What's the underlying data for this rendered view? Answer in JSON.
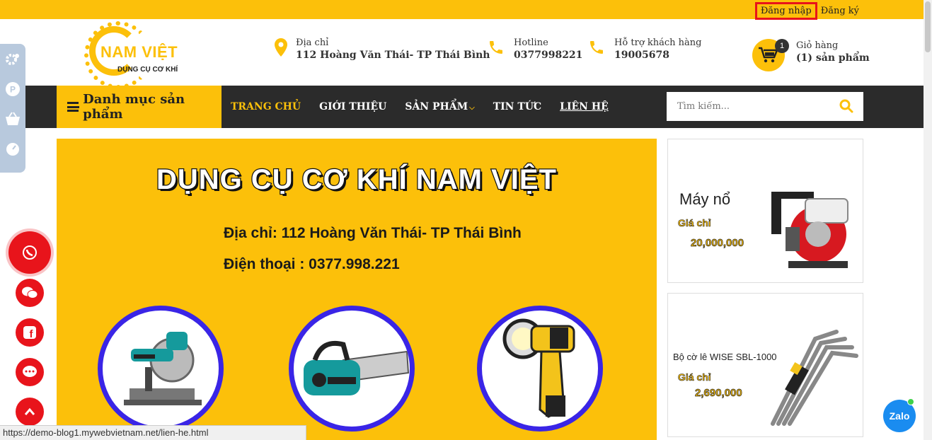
{
  "topbar": {
    "login": "Đăng nhập",
    "register": "Đăng ký"
  },
  "logo": {
    "name": "NAM VIỆT",
    "tagline": "DỤNG CỤ CƠ KHÍ"
  },
  "contact": {
    "address_label": "Địa chỉ",
    "address_value": "112 Hoàng Văn Thái- TP Thái Bình",
    "hotline_label": "Hotline",
    "hotline_value": "0377998221",
    "support_label": "Hỗ trợ khách hàng",
    "support_value": "19005678"
  },
  "cart": {
    "count": "1",
    "label": "Giỏ hàng",
    "value": "(1) sản phẩm"
  },
  "nav": {
    "category_button": "Danh mục sản phẩm",
    "items": [
      "TRANG CHỦ",
      "GIỚI THIỆU",
      "SẢN PHẨM",
      "TIN TỨC",
      "LIÊN HỆ"
    ]
  },
  "search": {
    "placeholder": "Tìm kiếm..."
  },
  "banner": {
    "title": "DỤNG CỤ CƠ KHÍ NAM VIỆT",
    "address": "Địa chỉ: 112 Hoàng Văn Thái- TP Thái Bình",
    "phone": "Điện thoại : 0377.998.221"
  },
  "side_ads": [
    {
      "name": "Máy nổ",
      "price_label": "Giá chỉ",
      "price": "20,000,000"
    },
    {
      "name": "Bộ cờ lê WISE SBL-1000",
      "price_label": "Giá chỉ",
      "price": "2,690,000"
    }
  ],
  "status_url": "https://demo-blog1.mywebvietnam.net/lien-he.html",
  "zalo": "Zalo",
  "colors": {
    "accent": "#fcc00a",
    "dark": "#2b2b2b",
    "social": "#e8141b",
    "ring": "#3a25e6"
  },
  "icons": [
    "map-pin-icon",
    "phone-icon",
    "cart-icon",
    "search-icon",
    "gear-icon",
    "p-icon",
    "basket-icon",
    "dashboard-icon",
    "whatsapp-icon",
    "wechat-icon",
    "facebook-icon",
    "chat-icon",
    "chevron-up-icon"
  ]
}
